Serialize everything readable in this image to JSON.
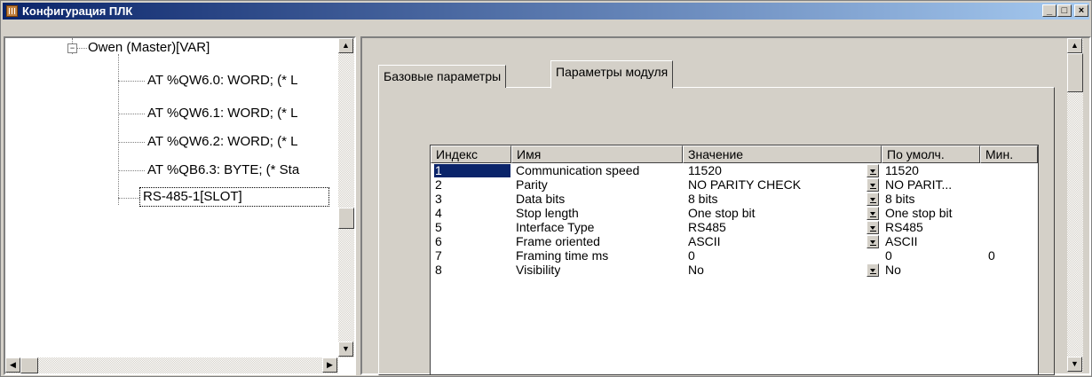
{
  "window": {
    "title": "Конфигурация ПЛК",
    "minimize": "_",
    "maximize": "□",
    "close": "×"
  },
  "tree": {
    "root": "Owen (Master)[VAR]",
    "children": [
      "AT %QW6.0: WORD; (* L",
      "AT %QW6.1: WORD; (* L",
      "AT %QW6.2: WORD; (* L",
      "AT %QB6.3: BYTE; (* Sta",
      "RS-485-1[SLOT]"
    ]
  },
  "tabs": [
    "Базовые параметры",
    "Параметры модуля"
  ],
  "grid": {
    "headers": [
      "Индекс",
      "Имя",
      "Значение",
      "По умолч.",
      "Мин."
    ],
    "rows": [
      {
        "index": "1",
        "name": "Communication speed",
        "value": "11520",
        "default": "11520",
        "min": ""
      },
      {
        "index": "2",
        "name": "Parity",
        "value": "NO PARITY CHECK",
        "default": "NO PARIT...",
        "min": ""
      },
      {
        "index": "3",
        "name": "Data bits",
        "value": "8 bits",
        "default": "8 bits",
        "min": ""
      },
      {
        "index": "4",
        "name": "Stop length",
        "value": "One stop bit",
        "default": "One stop bit",
        "min": ""
      },
      {
        "index": "5",
        "name": "Interface Type",
        "value": "RS485",
        "default": "RS485",
        "min": ""
      },
      {
        "index": "6",
        "name": "Frame oriented",
        "value": "ASCII",
        "default": "ASCII",
        "min": ""
      },
      {
        "index": "7",
        "name": "Framing time ms",
        "value": "0",
        "default": "0",
        "min": "0"
      },
      {
        "index": "8",
        "name": "Visibility",
        "value": "No",
        "default": "No",
        "min": ""
      }
    ]
  }
}
